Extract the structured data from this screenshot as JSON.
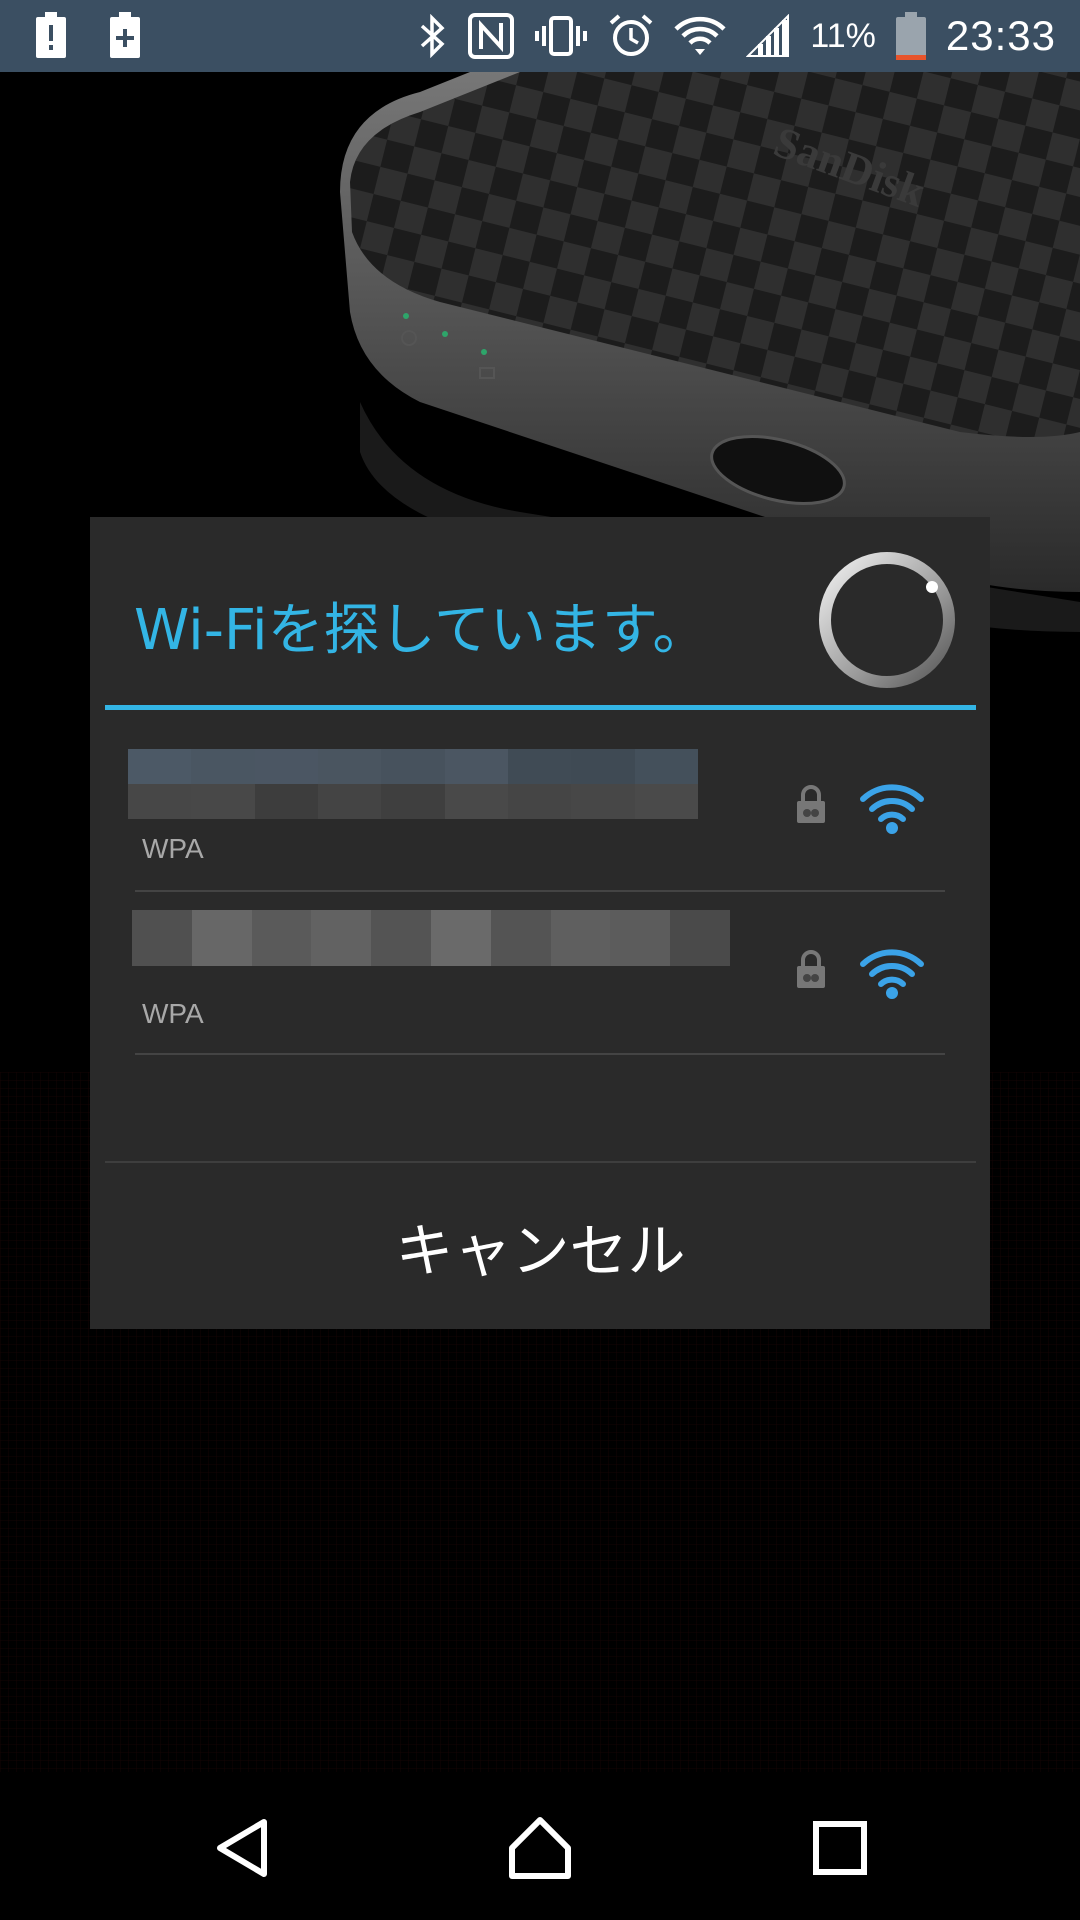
{
  "status_bar": {
    "icons_left": [
      "battery-alert-icon",
      "battery-plus-icon"
    ],
    "icons_right": [
      "bluetooth-icon",
      "nfc-icon",
      "vibrate-icon",
      "alarm-icon",
      "wifi-icon",
      "cell-signal-icon"
    ],
    "battery_percent": "11%",
    "battery_level": 0.11,
    "time": "23:33"
  },
  "background": {
    "device_brand": "SanDisk"
  },
  "dialog": {
    "title": "Wi-Fiを探しています。",
    "accent_color": "#33b5e5",
    "networks": [
      {
        "ssid": "",
        "ssid_obscured": true,
        "security": "WPA",
        "locked": true,
        "signal_icon": "wifi-signal-full-icon"
      },
      {
        "ssid": "",
        "ssid_obscured": true,
        "security": "WPA",
        "locked": true,
        "signal_icon": "wifi-signal-full-icon"
      }
    ],
    "cancel_label": "キャンセル"
  },
  "nav_bar": {
    "buttons": [
      "back-icon",
      "home-icon",
      "recents-icon"
    ]
  }
}
